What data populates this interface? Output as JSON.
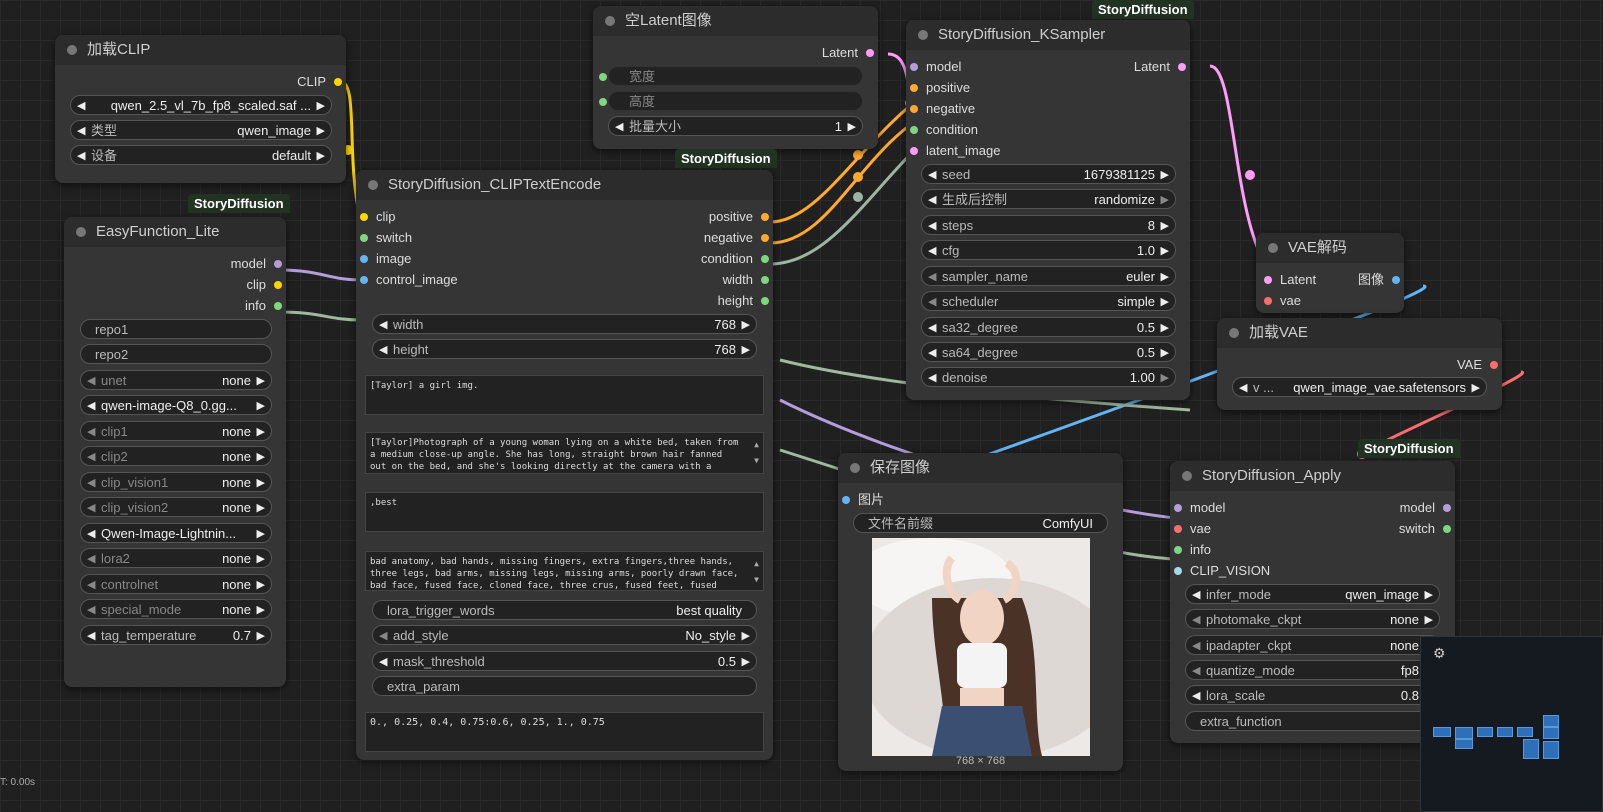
{
  "colors": {
    "model": "#b39ddb",
    "clip": "#ffd500",
    "info": "#7fd67f",
    "latent": "#ff9cf9",
    "vae": "#ff6e6e",
    "image": "#64b5f6",
    "positive": "#ffa931",
    "condition": "#a0c4a8"
  },
  "load_clip": {
    "title": "加载CLIP",
    "out_clip": "CLIP",
    "widgets": [
      {
        "label": "",
        "value": "qwen_2.5_vl_7b_fp8_scaled.saf ..."
      },
      {
        "label": "类型",
        "value": "qwen_image"
      },
      {
        "label": "设备",
        "value": "default"
      }
    ]
  },
  "easy_lite": {
    "badge": "StoryDiffusion",
    "title": "EasyFunction_Lite",
    "outputs": [
      "model",
      "clip",
      "info"
    ],
    "widgets": [
      {
        "label": "repo1",
        "value": ""
      },
      {
        "label": "repo2",
        "value": ""
      },
      {
        "label": "unet",
        "value": "none"
      },
      {
        "label": "",
        "value": "qwen-image-Q8_0.gg..."
      },
      {
        "label": "clip1",
        "value": "none"
      },
      {
        "label": "clip2",
        "value": "none"
      },
      {
        "label": "clip_vision1",
        "value": "none"
      },
      {
        "label": "clip_vision2",
        "value": "none"
      },
      {
        "label": "",
        "value": "Qwen-Image-Lightnin..."
      },
      {
        "label": "lora2",
        "value": "none"
      },
      {
        "label": "controlnet",
        "value": "none"
      },
      {
        "label": "special_mode",
        "value": "none"
      },
      {
        "label": "tag_temperature",
        "value": "0.7"
      }
    ]
  },
  "empty_latent": {
    "title": "空Latent图像",
    "out": "Latent",
    "widgets": [
      {
        "label": "宽度",
        "value": ""
      },
      {
        "label": "高度",
        "value": ""
      },
      {
        "label": "批量大小",
        "value": "1"
      }
    ]
  },
  "clip_encode": {
    "badge": "StoryDiffusion",
    "title": "StoryDiffusion_CLIPTextEncode",
    "inputs": [
      "clip",
      "switch",
      "image",
      "control_image"
    ],
    "outputs": [
      "positive",
      "negative",
      "condition",
      "width",
      "height"
    ],
    "width": {
      "label": "width",
      "value": "768"
    },
    "height": {
      "label": "height",
      "value": "768"
    },
    "text1": "[Taylor] a girl img.",
    "text2": "[Taylor]Photograph of a young woman lying on a white bed, taken from a medium close-up angle. She has long, straight brown hair fanned out on the bed, and she's looking directly at the camera with a neutral",
    "text3": ",best",
    "text4": "bad anatomy, bad hands, missing fingers, extra fingers,three hands, three legs, bad arms, missing legs, missing arms, poorly drawn face, bad face, fused face, cloned face, three crus, fused feet, fused thigh,",
    "lora_trigger": {
      "label": "lora_trigger_words",
      "value": "best quality"
    },
    "add_style": {
      "label": "add_style",
      "value": "No_style"
    },
    "mask": {
      "label": "mask_threshold",
      "value": "0.5"
    },
    "extra": {
      "label": "extra_param",
      "value": ""
    },
    "text5": "0., 0.25, 0.4, 0.75:0.6, 0.25, 1., 0.75"
  },
  "ksampler": {
    "badge": "StoryDiffusion",
    "title": "StoryDiffusion_KSampler",
    "inputs": [
      "model",
      "positive",
      "negative",
      "condition",
      "latent_image"
    ],
    "out": "Latent",
    "widgets": [
      {
        "label": "seed",
        "value": "1679381125"
      },
      {
        "label": "生成后控制",
        "value": "randomize"
      },
      {
        "label": "steps",
        "value": "8"
      },
      {
        "label": "cfg",
        "value": "1.0"
      },
      {
        "label": "sampler_name",
        "value": "euler"
      },
      {
        "label": "scheduler",
        "value": "simple"
      },
      {
        "label": "sa32_degree",
        "value": "0.5"
      },
      {
        "label": "sa64_degree",
        "value": "0.5"
      },
      {
        "label": "denoise",
        "value": "1.00"
      }
    ]
  },
  "vae_decode": {
    "title": "VAE解码",
    "inputs": [
      "Latent",
      "vae"
    ],
    "out": "图像"
  },
  "load_vae": {
    "title": "加载VAE",
    "out": "VAE",
    "widget": {
      "label": "v ...",
      "value": "qwen_image_vae.safetensors"
    }
  },
  "save_image": {
    "title": "保存图像",
    "input": "图片",
    "widget": {
      "label": "文件名前缀",
      "value": "ComfyUI"
    },
    "size": "768 × 768"
  },
  "apply": {
    "badge": "StoryDiffusion",
    "title": "StoryDiffusion_Apply",
    "inputs": [
      "model",
      "vae",
      "info",
      "CLIP_VISION"
    ],
    "outputs": [
      "model",
      "switch"
    ],
    "widgets": [
      {
        "label": "infer_mode",
        "value": "qwen_image"
      },
      {
        "label": "photomake_ckpt",
        "value": "none"
      },
      {
        "label": "ipadapter_ckpt",
        "value": "none"
      },
      {
        "label": "quantize_mode",
        "value": "fp8"
      },
      {
        "label": "lora_scale",
        "value": "0.8"
      },
      {
        "label": "extra_function",
        "value": ""
      }
    ]
  },
  "status": {
    "time": "T: 0.00s"
  },
  "minimap": {
    "icon": "sliders-icon"
  }
}
